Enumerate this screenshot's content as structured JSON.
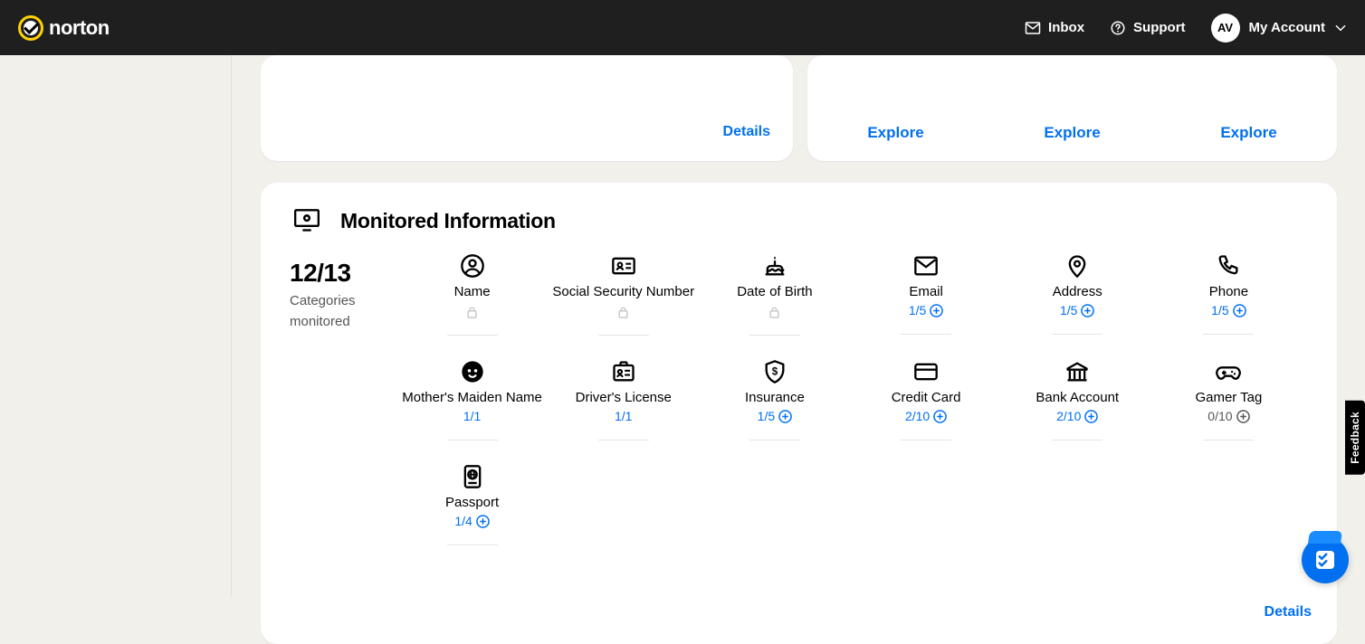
{
  "header": {
    "logo_text": "norton",
    "inbox": "Inbox",
    "support": "Support",
    "account_label": "My Account",
    "avatar_initials": "AV"
  },
  "top_left_card": {
    "details": "Details"
  },
  "top_right_card": {
    "explore": [
      "Explore",
      "Explore",
      "Explore"
    ]
  },
  "main_card": {
    "title": "Monitored Information",
    "summary_count": "12/13",
    "summary_label_1": "Categories",
    "summary_label_2": "monitored",
    "details": "Details",
    "tiles": [
      {
        "label": "Name",
        "locked": true
      },
      {
        "label": "Social Security Number",
        "locked": true
      },
      {
        "label": "Date of Birth",
        "locked": true
      },
      {
        "label": "Email",
        "status": "1/5",
        "addable": true
      },
      {
        "label": "Address",
        "status": "1/5",
        "addable": true
      },
      {
        "label": "Phone",
        "status": "1/5",
        "addable": true
      },
      {
        "label": "Mother's Maiden Name",
        "status": "1/1"
      },
      {
        "label": "Driver's License",
        "status": "1/1"
      },
      {
        "label": "Insurance",
        "status": "1/5",
        "addable": true
      },
      {
        "label": "Credit Card",
        "status": "2/10",
        "addable": true
      },
      {
        "label": "Bank Account",
        "status": "2/10",
        "addable": true
      },
      {
        "label": "Gamer Tag",
        "status": "0/10",
        "addable": true,
        "muted": true
      },
      {
        "label": "Passport",
        "status": "1/4",
        "addable": true
      }
    ],
    "tile_icon_names": [
      "user-circle-icon",
      "id-card-icon",
      "birthday-cake-icon",
      "envelope-icon",
      "map-pin-icon",
      "phone-icon",
      "face-icon",
      "license-icon",
      "shield-dollar-icon",
      "credit-card-icon",
      "bank-icon",
      "gamepad-icon",
      "passport-icon"
    ]
  },
  "feedback": "Feedback"
}
